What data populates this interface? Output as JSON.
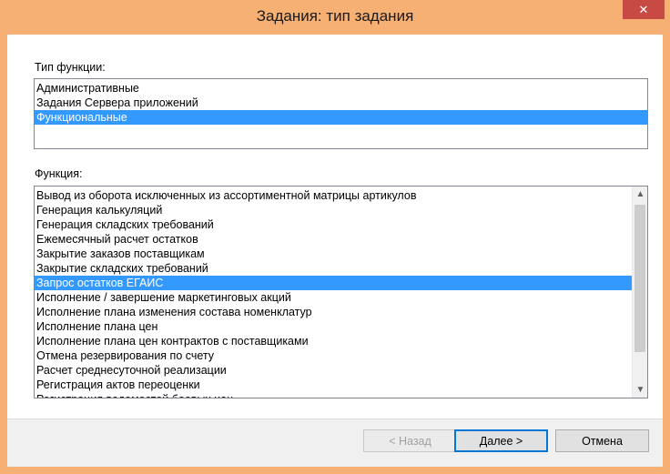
{
  "window": {
    "title": "Задания: тип задания",
    "close_glyph": "✕"
  },
  "function_type": {
    "label": "Тип функции:",
    "items": [
      {
        "label": "Административные",
        "selected": false
      },
      {
        "label": "Задания Сервера приложений",
        "selected": false
      },
      {
        "label": "Функциональные",
        "selected": true
      }
    ]
  },
  "function": {
    "label": "Функция:",
    "items": [
      {
        "label": "Вывод из оборота исключенных из ассортиментной матрицы артикулов",
        "selected": false
      },
      {
        "label": "Генерация калькуляций",
        "selected": false
      },
      {
        "label": "Генерация складских требований",
        "selected": false
      },
      {
        "label": "Ежемесячный расчет остатков",
        "selected": false
      },
      {
        "label": "Закрытие заказов поставщикам",
        "selected": false
      },
      {
        "label": "Закрытие складских требований",
        "selected": false
      },
      {
        "label": "Запрос остатков ЕГАИС",
        "selected": true
      },
      {
        "label": "Исполнение / завершение маркетинговых акций",
        "selected": false
      },
      {
        "label": "Исполнение плана изменения состава номенклатур",
        "selected": false
      },
      {
        "label": "Исполнение плана цен",
        "selected": false
      },
      {
        "label": "Исполнение плана цен контрактов с поставщиками",
        "selected": false
      },
      {
        "label": "Отмена резервирования по счету",
        "selected": false
      },
      {
        "label": "Расчет среднесуточной реализации",
        "selected": false
      },
      {
        "label": "Регистрация актов переоценки",
        "selected": false
      },
      {
        "label": "Регистрация ведомостей боевых цен",
        "selected": false
      }
    ]
  },
  "buttons": {
    "back": "< Назад",
    "next": "Далее >",
    "cancel": "Отмена"
  },
  "colors": {
    "frame": "#f6b073",
    "close": "#c74a44",
    "selection": "#3399ff"
  }
}
